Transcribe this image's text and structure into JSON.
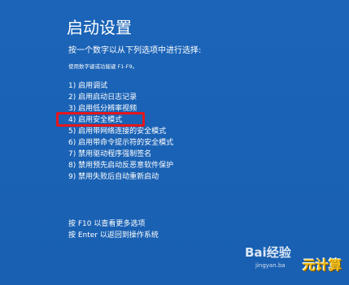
{
  "header": {
    "title": "启动设置",
    "prompt": "按一个数字以从下列选项中进行选择:",
    "hint": "使用数字键或功能键 F1-F9。"
  },
  "options": [
    {
      "label": "1) 启用调试"
    },
    {
      "label": "2) 启用启动日志记录"
    },
    {
      "label": "3) 启用低分辨率视频"
    },
    {
      "label": "4) 启用安全模式"
    },
    {
      "label": "5) 启用带网络连接的安全模式"
    },
    {
      "label": "6) 启用带命令提示符的安全模式"
    },
    {
      "label": "7) 禁用驱动程序强制签名"
    },
    {
      "label": "8) 禁用预先启动反恶意软件保护"
    },
    {
      "label": "9) 禁用失败后自动重新启动"
    }
  ],
  "highlighted_option": "4) 启用安全模式",
  "footer": {
    "more_options": "按 F10 以查看更多选项",
    "return_os": "按 Enter 以返回到操作系统"
  },
  "watermark": {
    "logo": "Bai经验",
    "url": "jingyan.ba",
    "corner": "元计算"
  },
  "colors": {
    "background": "#1a62b6",
    "text": "#ffffff",
    "highlight_border": "#e3171d",
    "corner_watermark": "#f4c51c"
  }
}
